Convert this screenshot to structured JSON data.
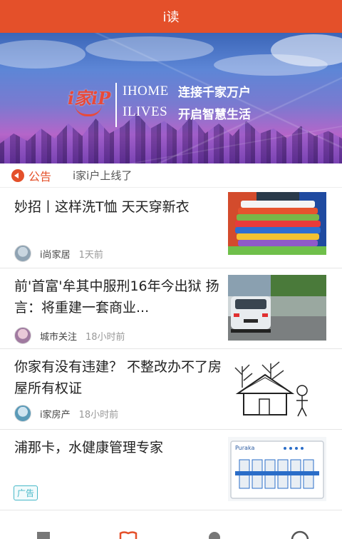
{
  "header": {
    "title": "i读"
  },
  "banner": {
    "logo_text": "i家iP",
    "line1_en": "IHOME",
    "line1_cn": "连接千家万户",
    "line2_en": "ILIVES",
    "line2_cn": "开启智慧生活"
  },
  "notice": {
    "label": "公告",
    "text": "i家i户上线了"
  },
  "articles": [
    {
      "title": "妙招丨这样洗T恤 天天穿新衣",
      "source": "i尚家居",
      "time": "1天前"
    },
    {
      "title": "前'首富'牟其中服刑16年今出狱 扬言：将重建一套商业...",
      "source": "城市关注",
      "time": "18小时前"
    },
    {
      "title": "你家有没有违建？ 不整改办不了房屋所有权证",
      "source": "i家房产",
      "time": "18小时前"
    },
    {
      "title": "浦那卡，水健康管理专家",
      "badge": "广告",
      "product_brand": "Puraka"
    }
  ],
  "colors": {
    "accent": "#e4502a",
    "ad": "#47b8c8"
  },
  "tabbar": {
    "icons": [
      "building-icon",
      "book-icon",
      "people-icon",
      "user-icon"
    ],
    "active": "book-icon"
  }
}
